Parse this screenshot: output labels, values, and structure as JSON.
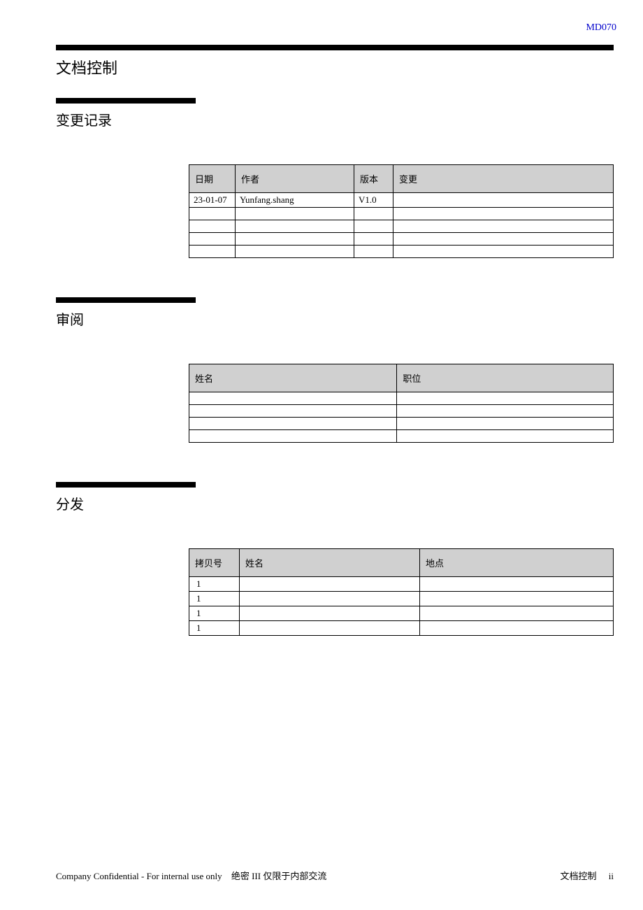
{
  "header": {
    "doc_id": "MD070"
  },
  "title": "文档控制",
  "sections": {
    "changelog": {
      "heading": "变更记录",
      "cols": {
        "date": "日期",
        "author": "作者",
        "version": "版本",
        "change": "变更"
      },
      "rows": [
        {
          "date": "23-01-07",
          "author": "Yunfang.shang",
          "version": "V1.0",
          "change": ""
        },
        {
          "date": "",
          "author": "",
          "version": "",
          "change": ""
        },
        {
          "date": "",
          "author": "",
          "version": "",
          "change": ""
        },
        {
          "date": "",
          "author": "",
          "version": "",
          "change": ""
        },
        {
          "date": "",
          "author": "",
          "version": "",
          "change": ""
        }
      ]
    },
    "review": {
      "heading": "审阅",
      "cols": {
        "name": "姓名",
        "position": "职位"
      },
      "rows": [
        {
          "name": "",
          "position": ""
        },
        {
          "name": "",
          "position": ""
        },
        {
          "name": "",
          "position": ""
        },
        {
          "name": "",
          "position": ""
        }
      ]
    },
    "distribution": {
      "heading": "分发",
      "cols": {
        "copy": "拷贝号",
        "name": "姓名",
        "location": "地点"
      },
      "rows": [
        {
          "copy": "1",
          "name": "",
          "location": ""
        },
        {
          "copy": "1",
          "name": "",
          "location": ""
        },
        {
          "copy": "1",
          "name": "",
          "location": ""
        },
        {
          "copy": "1",
          "name": "",
          "location": ""
        }
      ]
    }
  },
  "footer": {
    "left_en": "Company Confidential - For internal use only",
    "left_cn": "绝密 III  仅限于内部交流",
    "right_label": "文档控制",
    "page": "ii"
  }
}
